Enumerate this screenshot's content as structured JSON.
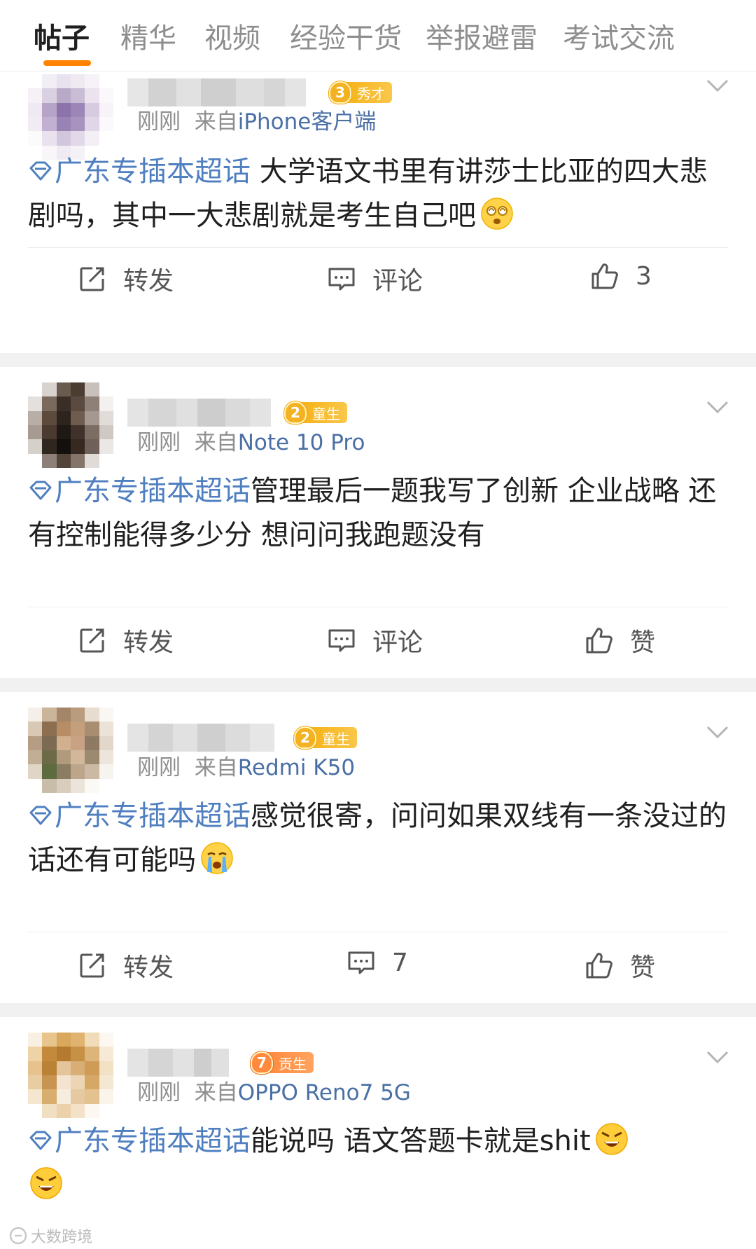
{
  "tabs": [
    {
      "label": "帖子",
      "active": true
    },
    {
      "label": "精华",
      "active": false
    },
    {
      "label": "视频",
      "active": false
    },
    {
      "label": "经验干货",
      "active": false
    },
    {
      "label": "举报避雷",
      "active": false
    },
    {
      "label": "考试交流",
      "active": false
    }
  ],
  "accent_color": "#ff8200",
  "topic_color": "#4f7fc0",
  "posts": [
    {
      "level": "3",
      "level_title": "秀才",
      "time": "刚刚",
      "from_label": "来自",
      "source": "iPhone客户端",
      "topic": "广东专插本超话",
      "text": " 大学语文书里有讲莎士比亚的四大悲剧吗，其中一大悲剧就是考生自己吧",
      "emoji": "dizzy-face-emoji",
      "repost": "转发",
      "comment": "评论",
      "like": "3"
    },
    {
      "level": "2",
      "level_title": "童生",
      "time": "刚刚",
      "from_label": "来自",
      "source": "Note 10 Pro",
      "topic": "广东专插本超话",
      "text": "管理最后一题我写了创新 企业战略 还有控制能得多少分 想问问我跑题没有",
      "emoji": "",
      "repost": "转发",
      "comment": "评论",
      "like": "赞"
    },
    {
      "level": "2",
      "level_title": "童生",
      "time": "刚刚",
      "from_label": "来自",
      "source": "Redmi K50",
      "topic": "广东专插本超话",
      "text": "感觉很寄，问问如果双线有一条没过的话还有可能吗",
      "emoji": "crying-face-emoji",
      "repost": "转发",
      "comment": "7",
      "like": "赞"
    },
    {
      "level": "7",
      "level_title": "贡生",
      "time": "刚刚",
      "from_label": "来自",
      "source": "OPPO Reno7 5G",
      "topic": "广东专插本超话",
      "text": "能说吗 语文答题卡就是shit",
      "emoji": "angry-face-emoji",
      "repost": "",
      "comment": "",
      "like": ""
    }
  ],
  "watermark": "大数跨境"
}
